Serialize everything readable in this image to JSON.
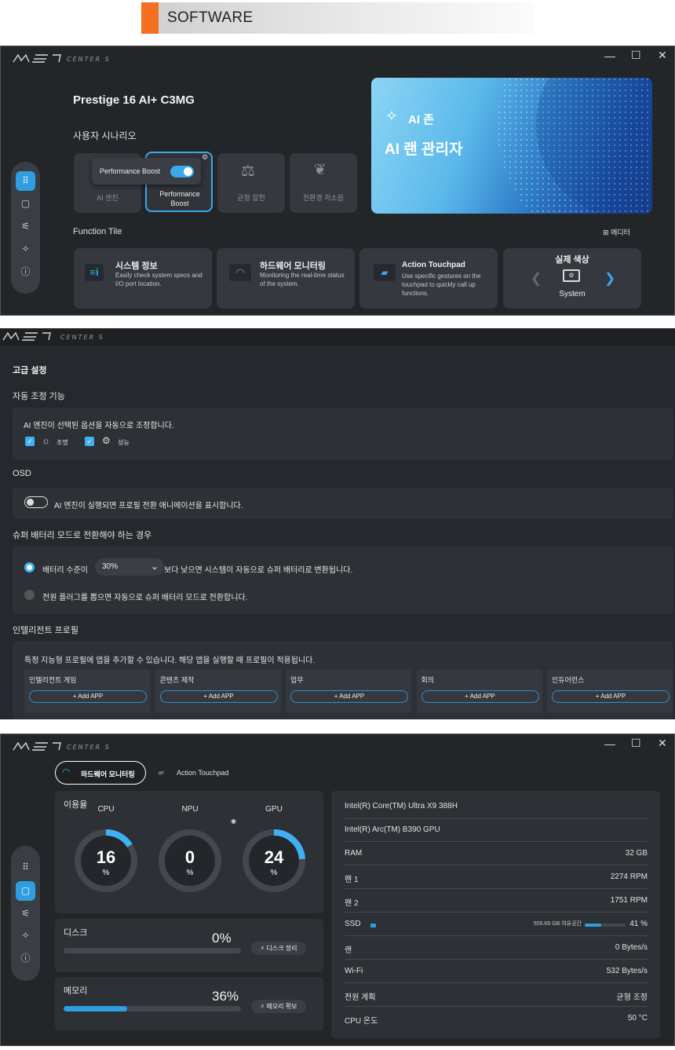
{
  "banner": {
    "title": "SOFTWARE"
  },
  "app": {
    "logo_text": "msi",
    "logo_sub": "CENTER S"
  },
  "window1": {
    "device_name": "Prestige 16 AI+ C3MG",
    "scenario_title": "사용자 시나리오",
    "scenarios": [
      {
        "label": "AI 엔진"
      },
      {
        "label": "Performance Boost"
      },
      {
        "label": "균형 잡힌"
      },
      {
        "label": "친환경 저소음"
      }
    ],
    "popover_label": "Performance Boost",
    "ai_zone_label": "AI 존",
    "ai_zone_title": "AI 랜 관리자",
    "function_tile_title": "Function Tile",
    "editor_label": "에디터",
    "tiles": [
      {
        "title": "시스템 정보",
        "desc": "Easily check system specs and I/O port location."
      },
      {
        "title": "하드웨어 모니터링",
        "desc": "Monitoring the real-time status of the system."
      },
      {
        "title": "Action Touchpad",
        "desc": "Use specific gestures on the touchpad to quickly call up functions."
      }
    ],
    "color_tile": {
      "title": "실제 색상",
      "mode": "System"
    }
  },
  "window2": {
    "page_title": "고급 설정",
    "auto_title": "자동 조정 기능",
    "auto_desc": "AI 엔진이 선택된 옵션을 자동으로 조정합니다.",
    "auto_opt1": "조명",
    "auto_opt2": "성능",
    "osd_title": "OSD",
    "osd_desc": "AI 엔진이 실행되면 프로필 전환 애니메이션을 표시합니다.",
    "battery_title": "슈퍼 배터리 모드로 전환해야 하는 경우",
    "battery_opt1_pre": "배터리 수준이",
    "battery_level": "30%",
    "battery_opt1_post": "보다 낮으면 시스템이 자동으로 슈퍼 배터리로 변환됩니다.",
    "battery_opt2": "전원 플러그를 뽑으면 자동으로 슈퍼 배터리 모드로 전환합니다.",
    "profile_title": "인텔리전트 프로필",
    "profile_desc": "특정 지능형 프로필에 앱을 추가할 수 있습니다. 해당 앱을 실행할 때 프로필이 적용됩니다.",
    "profiles": [
      {
        "label": "인텔리전트 게임",
        "button": "Add APP"
      },
      {
        "label": "콘텐츠 제작",
        "button": "Add APP"
      },
      {
        "label": "업무",
        "button": "Add APP"
      },
      {
        "label": "회의",
        "button": "Add APP"
      },
      {
        "label": "인듀어런스",
        "button": "Add APP"
      }
    ]
  },
  "window3": {
    "tab_active": "하드웨어 모니터링",
    "tab_other": "Action Touchpad",
    "usage_label": "이용율",
    "gauges": [
      {
        "name": "CPU",
        "value": "16",
        "unit": "%",
        "percent": 16
      },
      {
        "name": "NPU",
        "value": "0",
        "unit": "%",
        "percent": 0
      },
      {
        "name": "GPU",
        "value": "24",
        "unit": "%",
        "percent": 24
      }
    ],
    "disk": {
      "label": "디스크",
      "value": "0%",
      "percent": 0,
      "button": "디스크 정리"
    },
    "memory": {
      "label": "메모리",
      "value": "36%",
      "percent": 36,
      "button": "메모리 확보"
    },
    "cpu_name": "Intel(R) Core(TM) Ultra X9 388H",
    "gpu_name": "Intel(R) Arc(TM) B390 GPU",
    "rows": [
      {
        "label": "RAM",
        "value": "32 GB"
      },
      {
        "label": "팬 1",
        "value": "2274 RPM"
      },
      {
        "label": "팬 2",
        "value": "1751 RPM"
      },
      {
        "label": "SSD",
        "value": "41 %"
      },
      {
        "label": "랜",
        "value": "0 Bytes/s"
      },
      {
        "label": "Wi-Fi",
        "value": "532 Bytes/s"
      },
      {
        "label": "전원 계획",
        "value": "균형 조정"
      },
      {
        "label": "CPU 온도",
        "value": "50 °C"
      }
    ],
    "ssd_free": "555.65 GB 여유공간",
    "ssd_percent": 41
  },
  "colors": {
    "accent": "#2e9ee0",
    "banner_orange": "#f36f21",
    "bg": "#232629",
    "panel": "#2d3035"
  }
}
